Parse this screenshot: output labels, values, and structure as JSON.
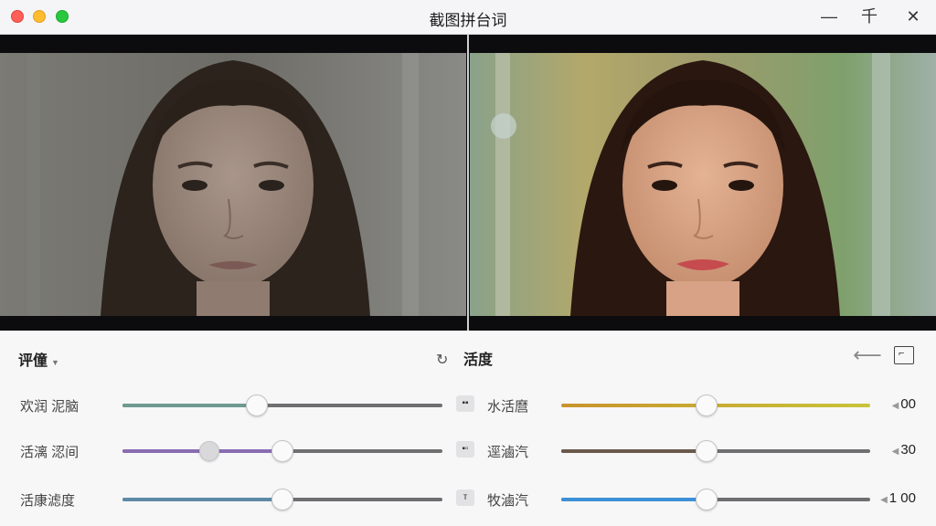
{
  "window": {
    "title": "截图拼台词",
    "minimize_glyph": "—",
    "maximize_glyph": "千",
    "close_glyph": "✕"
  },
  "preview": {
    "before_image": "portrait-before-muted",
    "after_image": "portrait-after-vivid"
  },
  "toolbar": {
    "preset_label": "评僮",
    "mode_label": "活度",
    "mode_icon": "rotate-icon",
    "back_icon": "arrow-left-icon",
    "compare_icon": "compare-icon"
  },
  "sliders_left": [
    {
      "label": "欢润  泥脑",
      "value": 0.42,
      "fill_color": "#6f9a8f",
      "chip": "▪▪"
    },
    {
      "label": "活漓  涊间",
      "value": 0.5,
      "fill_color": "#8a6db0",
      "chip": "▪▫",
      "ghost_value": 0.27
    },
    {
      "label": "活康滤度",
      "value": 0.5,
      "fill_color": "#5d8aa6",
      "chip": "ᴛ"
    }
  ],
  "sliders_right": [
    {
      "label": "水活麿",
      "value": 0.47,
      "display": "00",
      "fill_color": "#c9932e",
      "end_color": "#c8c43a"
    },
    {
      "label": "逕滷汽",
      "value": 0.47,
      "display": "30",
      "fill_color": "#6b5a4c"
    },
    {
      "label": "牧滷汽",
      "value": 0.47,
      "display": "1 00",
      "fill_color": "#3d8fd6"
    }
  ]
}
